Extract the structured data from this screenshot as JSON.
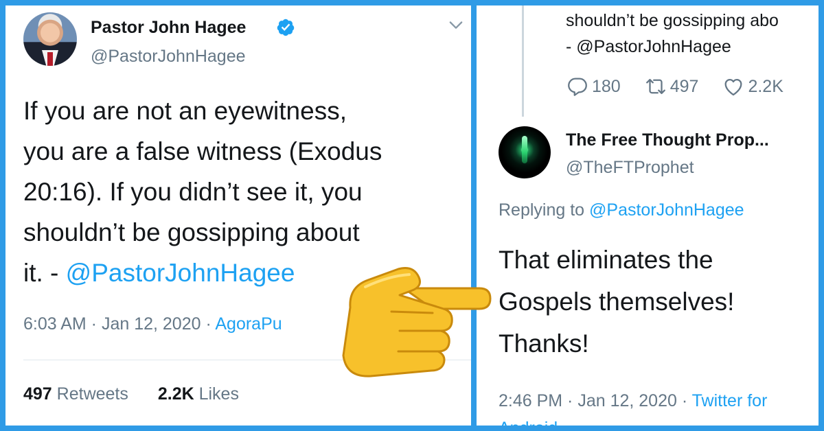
{
  "left_tweet": {
    "author": {
      "display_name": "Pastor John Hagee",
      "handle": "@PastorJohnHagee",
      "verified": true
    },
    "text_lines": [
      "If you are not an eyewitness,",
      "you are a false witness (Exodus",
      "20:16). If you didn’t see it, you",
      "shouldn’t be gossipping about"
    ],
    "last_line_prefix": "it. - ",
    "last_line_mention": "@PastorJohnHagee",
    "timestamp": "6:03 AM · Jan 12, 2020 · ",
    "source": "AgoraPu",
    "stats": {
      "retweets_count": "497",
      "retweets_label": " Retweets",
      "likes_count": "2.2K",
      "likes_label": " Likes"
    }
  },
  "right_tweet": {
    "quoted": {
      "line1": "shouldn’t be gossipping abo",
      "line2": "- @PastorJohnHagee",
      "replies": "180",
      "retweets": "497",
      "likes": "2.2K"
    },
    "author": {
      "display_name": "The Free Thought Prop...",
      "handle": "@TheFTProphet"
    },
    "replying_label": "Replying to ",
    "replying_to": "@PastorJohnHagee",
    "text_lines": [
      "That eliminates the",
      "Gospels themselves!",
      "Thanks!"
    ],
    "timestamp": "2:46 PM · Jan 12, 2020 · ",
    "source_line1": "Twitter for",
    "source_line2": "Android"
  },
  "icons": {
    "verified": "verified-badge-icon",
    "chevron": "chevron-down-icon",
    "reply": "reply-icon",
    "retweet": "retweet-icon",
    "like": "heart-icon",
    "pointer": "pointing-hand-icon"
  },
  "colors": {
    "background": "#2f9be6",
    "link": "#1da1f2",
    "muted": "#657786",
    "text": "#14171a",
    "hand": "#f7c12b"
  }
}
